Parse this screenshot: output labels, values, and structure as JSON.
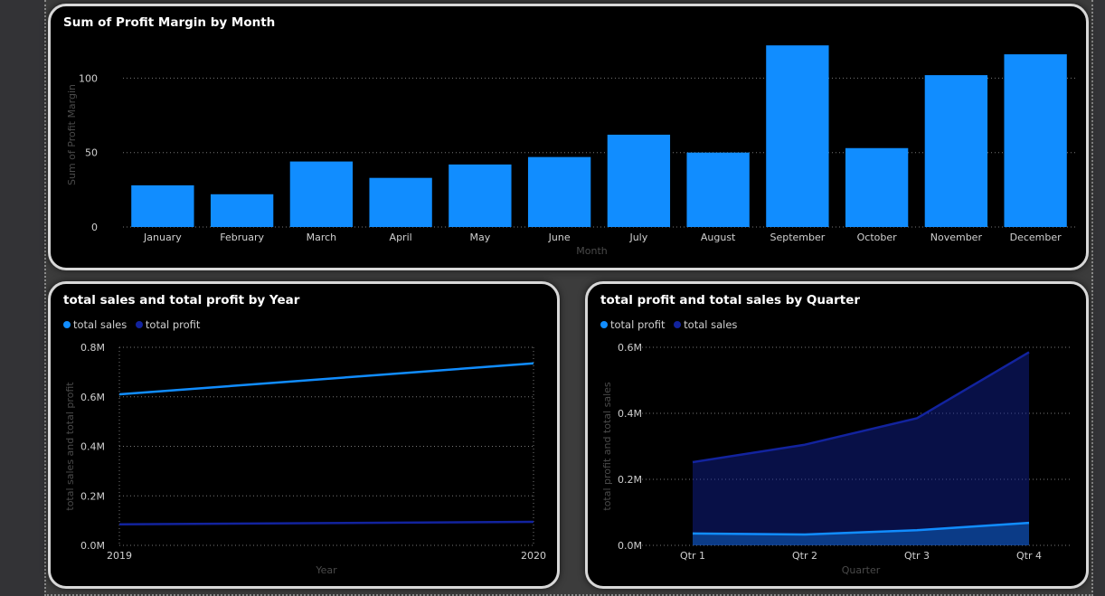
{
  "colors": {
    "bar": "#118DFF",
    "series_light": "#118DFF",
    "series_dark": "#12239E",
    "axis_text": "#d0d0d0",
    "axis_title": "#4a4a4a",
    "grid": "#777777"
  },
  "charts": {
    "month": {
      "title": "Sum of Profit Margin by Month"
    },
    "year": {
      "title": "total sales and total profit by Year",
      "legend": [
        "total sales",
        "total profit"
      ]
    },
    "quarter": {
      "title": "total profit and total sales by Quarter",
      "legend": [
        "total profit",
        "total sales"
      ]
    }
  },
  "chart_data": [
    {
      "type": "bar",
      "title": "Sum of Profit Margin by Month",
      "xlabel": "Month",
      "ylabel": "Sum of Profit Margin",
      "categories": [
        "January",
        "February",
        "March",
        "April",
        "May",
        "June",
        "July",
        "August",
        "September",
        "October",
        "November",
        "December"
      ],
      "values": [
        28,
        22,
        44,
        33,
        42,
        47,
        62,
        50,
        122,
        53,
        102,
        116
      ],
      "ylim": [
        0,
        130
      ],
      "yticks": [
        0,
        50,
        100
      ],
      "ytick_labels": [
        "0",
        "50",
        "100"
      ],
      "grid": true
    },
    {
      "type": "line",
      "title": "total sales and total profit by Year",
      "xlabel": "Year",
      "ylabel": "total sales and total profit",
      "categories": [
        "2019",
        "2020"
      ],
      "series": [
        {
          "name": "total sales",
          "values": [
            0.61,
            0.735
          ]
        },
        {
          "name": "total profit",
          "values": [
            0.085,
            0.095
          ]
        }
      ],
      "ylim": [
        0,
        0.8
      ],
      "yticks": [
        0,
        0.2,
        0.4,
        0.6,
        0.8
      ],
      "ytick_labels": [
        "0.0M",
        "0.2M",
        "0.4M",
        "0.6M",
        "0.8M"
      ],
      "grid": true,
      "legend_position": "top-left"
    },
    {
      "type": "area",
      "title": "total profit and total sales by Quarter",
      "xlabel": "Quarter",
      "ylabel": "total profit and total sales",
      "categories": [
        "Qtr 1",
        "Qtr 2",
        "Qtr 3",
        "Qtr 4"
      ],
      "series": [
        {
          "name": "total profit",
          "values": [
            0.036,
            0.033,
            0.046,
            0.068
          ]
        },
        {
          "name": "total sales",
          "values": [
            0.252,
            0.305,
            0.385,
            0.585
          ]
        }
      ],
      "ylim": [
        0,
        0.6
      ],
      "yticks": [
        0,
        0.2,
        0.4,
        0.6
      ],
      "ytick_labels": [
        "0.0M",
        "0.2M",
        "0.4M",
        "0.6M"
      ],
      "grid": true,
      "legend_position": "top-left"
    }
  ]
}
